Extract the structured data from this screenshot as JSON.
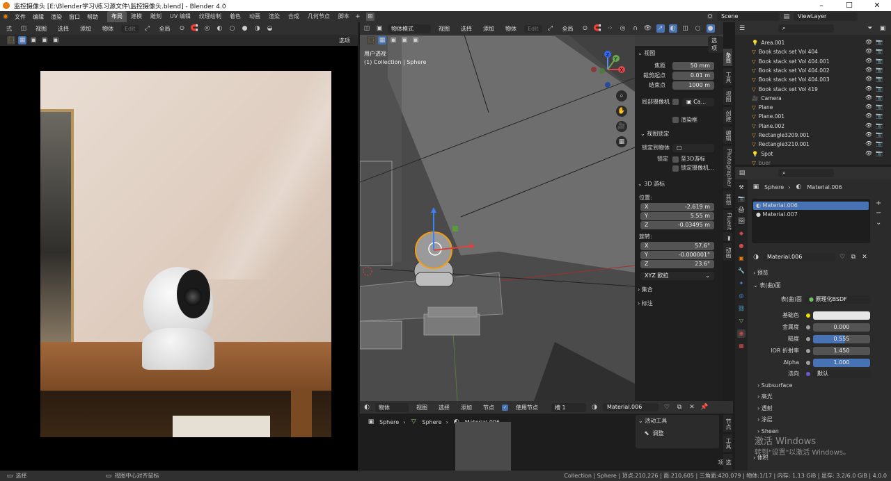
{
  "title": "监控摄像头 [E:\\Blender学习\\练习源文件\\监控摄像头.blend] - Blender 4.0",
  "menu": [
    "文件",
    "编辑",
    "渲染",
    "窗口",
    "帮助"
  ],
  "workspaces": [
    "布局",
    "建模",
    "雕刻",
    "UV 编辑",
    "纹理绘制",
    "着色",
    "动画",
    "渲染",
    "合成",
    "几何节点",
    "脚本"
  ],
  "active_workspace": "布局",
  "scene": "Scene",
  "view_layer": "ViewLayer",
  "left_header": {
    "items": [
      "式",
      "视图",
      "选择",
      "添加",
      "物体"
    ],
    "edit": "Edit",
    "global": "全局",
    "options": "选项"
  },
  "viewport": {
    "mode": "物体模式",
    "menus": [
      "视图",
      "选择",
      "添加",
      "物体"
    ],
    "edit": "Edit",
    "global": "全局",
    "options": "选项",
    "view_title": "用户透视",
    "view_sub": "(1) Collection | Sphere"
  },
  "npanel": {
    "view_header": "视图",
    "focal_label": "焦距",
    "focal": "50 mm",
    "clip_start_label": "裁剪起点",
    "clip_start": "0.01 m",
    "clip_end_label": "结束点",
    "clip_end": "1000 m",
    "local_cam_label": "局部摄像机",
    "local_cam": "Ca...",
    "render_region": "渲染框",
    "view_lock_header": "视图锁定",
    "lock_obj_label": "锁定到物体",
    "lock_label": "锁定",
    "lock_3d_cursor": "至3D游标",
    "lock_camera": "锁定摄像机...",
    "cursor_header": "3D 游标",
    "location_label": "位置:",
    "x": "-2.619 m",
    "y": "5.55 m",
    "z": "-0.03495 m",
    "rotation_label": "旋转:",
    "rx": "57.6°",
    "ry": "-0.000001°",
    "rz": "23.6°",
    "rot_mode": "XYZ 欧拉",
    "collections": "集合",
    "annotations": "标注"
  },
  "side_tabs": [
    "条目",
    "工具",
    "视图",
    "创建",
    "编辑",
    "Photographer",
    "其他",
    "Fluent",
    "动画"
  ],
  "outliner": {
    "items": [
      "Area.001",
      "Book stack set Vol 404",
      "Book stack set Vol 404.001",
      "Book stack set Vol 404.002",
      "Book stack set Vol 404.003",
      "Book stack set Vol 419",
      "Camera",
      "Plane",
      "Plane.001",
      "Plane.002",
      "Rectangle3209.001",
      "Rectangle3210.001",
      "Spot",
      "buer"
    ]
  },
  "properties": {
    "object": "Sphere",
    "material": "Material.006",
    "slots": [
      "Material.006",
      "Material.007"
    ],
    "material_field": "Material.006",
    "preview": "预览",
    "surface_header": "表(曲)面",
    "surface_label": "表(曲)面",
    "shader": "原理化BSDF",
    "base_color": "基础色",
    "metallic_label": "金属度",
    "metallic": "0.000",
    "roughness_label": "糙度",
    "roughness": "0.555",
    "ior_label": "IOR 折射率",
    "ior": "1.450",
    "alpha_label": "Alpha",
    "alpha": "1.000",
    "normal_label": "法向",
    "normal": "默认",
    "sections": [
      "Subsurface",
      "高光",
      "透射",
      "涂层",
      "Sheen"
    ],
    "volume": "体积"
  },
  "shader_editor": {
    "type": "物体",
    "menus": [
      "视图",
      "选择",
      "添加",
      "节点"
    ],
    "use_nodes": "使用节点",
    "slot": "槽 1",
    "material": "Material.006",
    "breadcrumb": [
      "Sphere",
      "Sphere",
      "Material.006"
    ],
    "active_tool": "活动工具",
    "tool": "调整",
    "tabs": [
      "节点",
      "工具",
      "选项"
    ]
  },
  "watermark": {
    "line1": "激活 Windows",
    "line2": "转到\"设置\"以激活 Windows。"
  },
  "statusbar": {
    "left1": "选择",
    "left2": "视图中心对齐鼠标",
    "right": "Collection | Sphere | 顶点:210,226 | 面:210,605 | 三角面:420,079 | 物体:1/17 | 内存: 1.13 GiB | 显存: 3.2/6.0 GiB | 4.0.0"
  }
}
